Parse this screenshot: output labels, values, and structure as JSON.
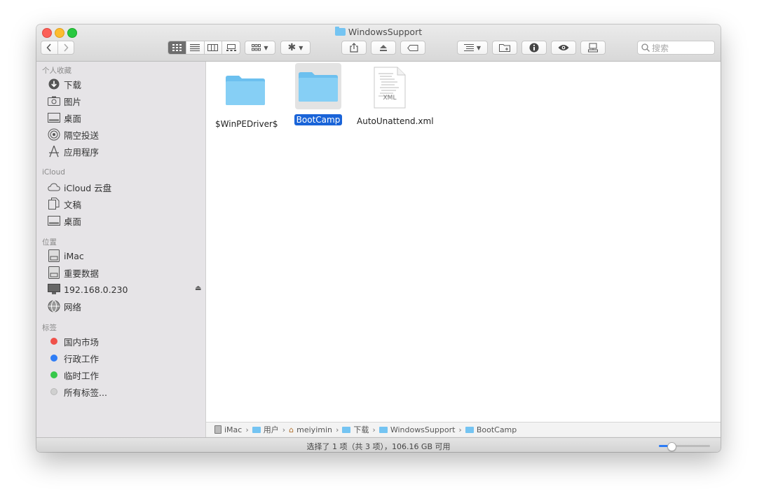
{
  "window": {
    "title": "WindowsSupport"
  },
  "toolbar": {
    "back_icon": "chevron-left-icon",
    "forward_icon": "chevron-right-icon",
    "view_modes": [
      "icon-view",
      "list-view",
      "column-view",
      "gallery-view"
    ],
    "active_view": "icon-view",
    "search_placeholder": "搜索"
  },
  "sidebar": {
    "sections": [
      {
        "title": "个人收藏",
        "items": [
          {
            "label": "下载",
            "icon": "download-icon"
          },
          {
            "label": "图片",
            "icon": "camera-icon"
          },
          {
            "label": "桌面",
            "icon": "desktop-icon"
          },
          {
            "label": "隔空投送",
            "icon": "airdrop-icon"
          },
          {
            "label": "应用程序",
            "icon": "applications-icon"
          }
        ]
      },
      {
        "title": "iCloud",
        "items": [
          {
            "label": "iCloud 云盘",
            "icon": "cloud-icon"
          },
          {
            "label": "文稿",
            "icon": "documents-icon"
          },
          {
            "label": "桌面",
            "icon": "desktop-icon"
          }
        ]
      },
      {
        "title": "位置",
        "items": [
          {
            "label": "iMac",
            "icon": "harddisk-icon"
          },
          {
            "label": "重要数据",
            "icon": "harddisk-icon"
          },
          {
            "label": "192.168.0.230",
            "icon": "display-icon"
          },
          {
            "label": "网络",
            "icon": "network-icon"
          }
        ]
      },
      {
        "title": "标签",
        "items": [
          {
            "label": "国内市场",
            "color": "#f0514a"
          },
          {
            "label": "行政工作",
            "color": "#2f7df6"
          },
          {
            "label": "临时工作",
            "color": "#36c84a"
          },
          {
            "label": "所有标签...",
            "color": "#d0d0d0"
          }
        ]
      }
    ]
  },
  "files": [
    {
      "name": "$WinPEDriver$",
      "type": "folder",
      "selected": false
    },
    {
      "name": "BootCamp",
      "type": "folder",
      "selected": true
    },
    {
      "name": "AutoUnattend.xml",
      "type": "xml",
      "badge": "XML",
      "selected": false
    }
  ],
  "pathbar": [
    {
      "label": "iMac",
      "icon": "harddisk-icon"
    },
    {
      "label": "用户",
      "icon": "folder-icon"
    },
    {
      "label": "meiyimin",
      "icon": "home-icon"
    },
    {
      "label": "下载",
      "icon": "folder-icon"
    },
    {
      "label": "WindowsSupport",
      "icon": "folder-icon"
    },
    {
      "label": "BootCamp",
      "icon": "folder-icon"
    }
  ],
  "status": {
    "text": "选择了 1 项（共 3 项），106.16 GB 可用",
    "icon_size_level": 0.25
  }
}
